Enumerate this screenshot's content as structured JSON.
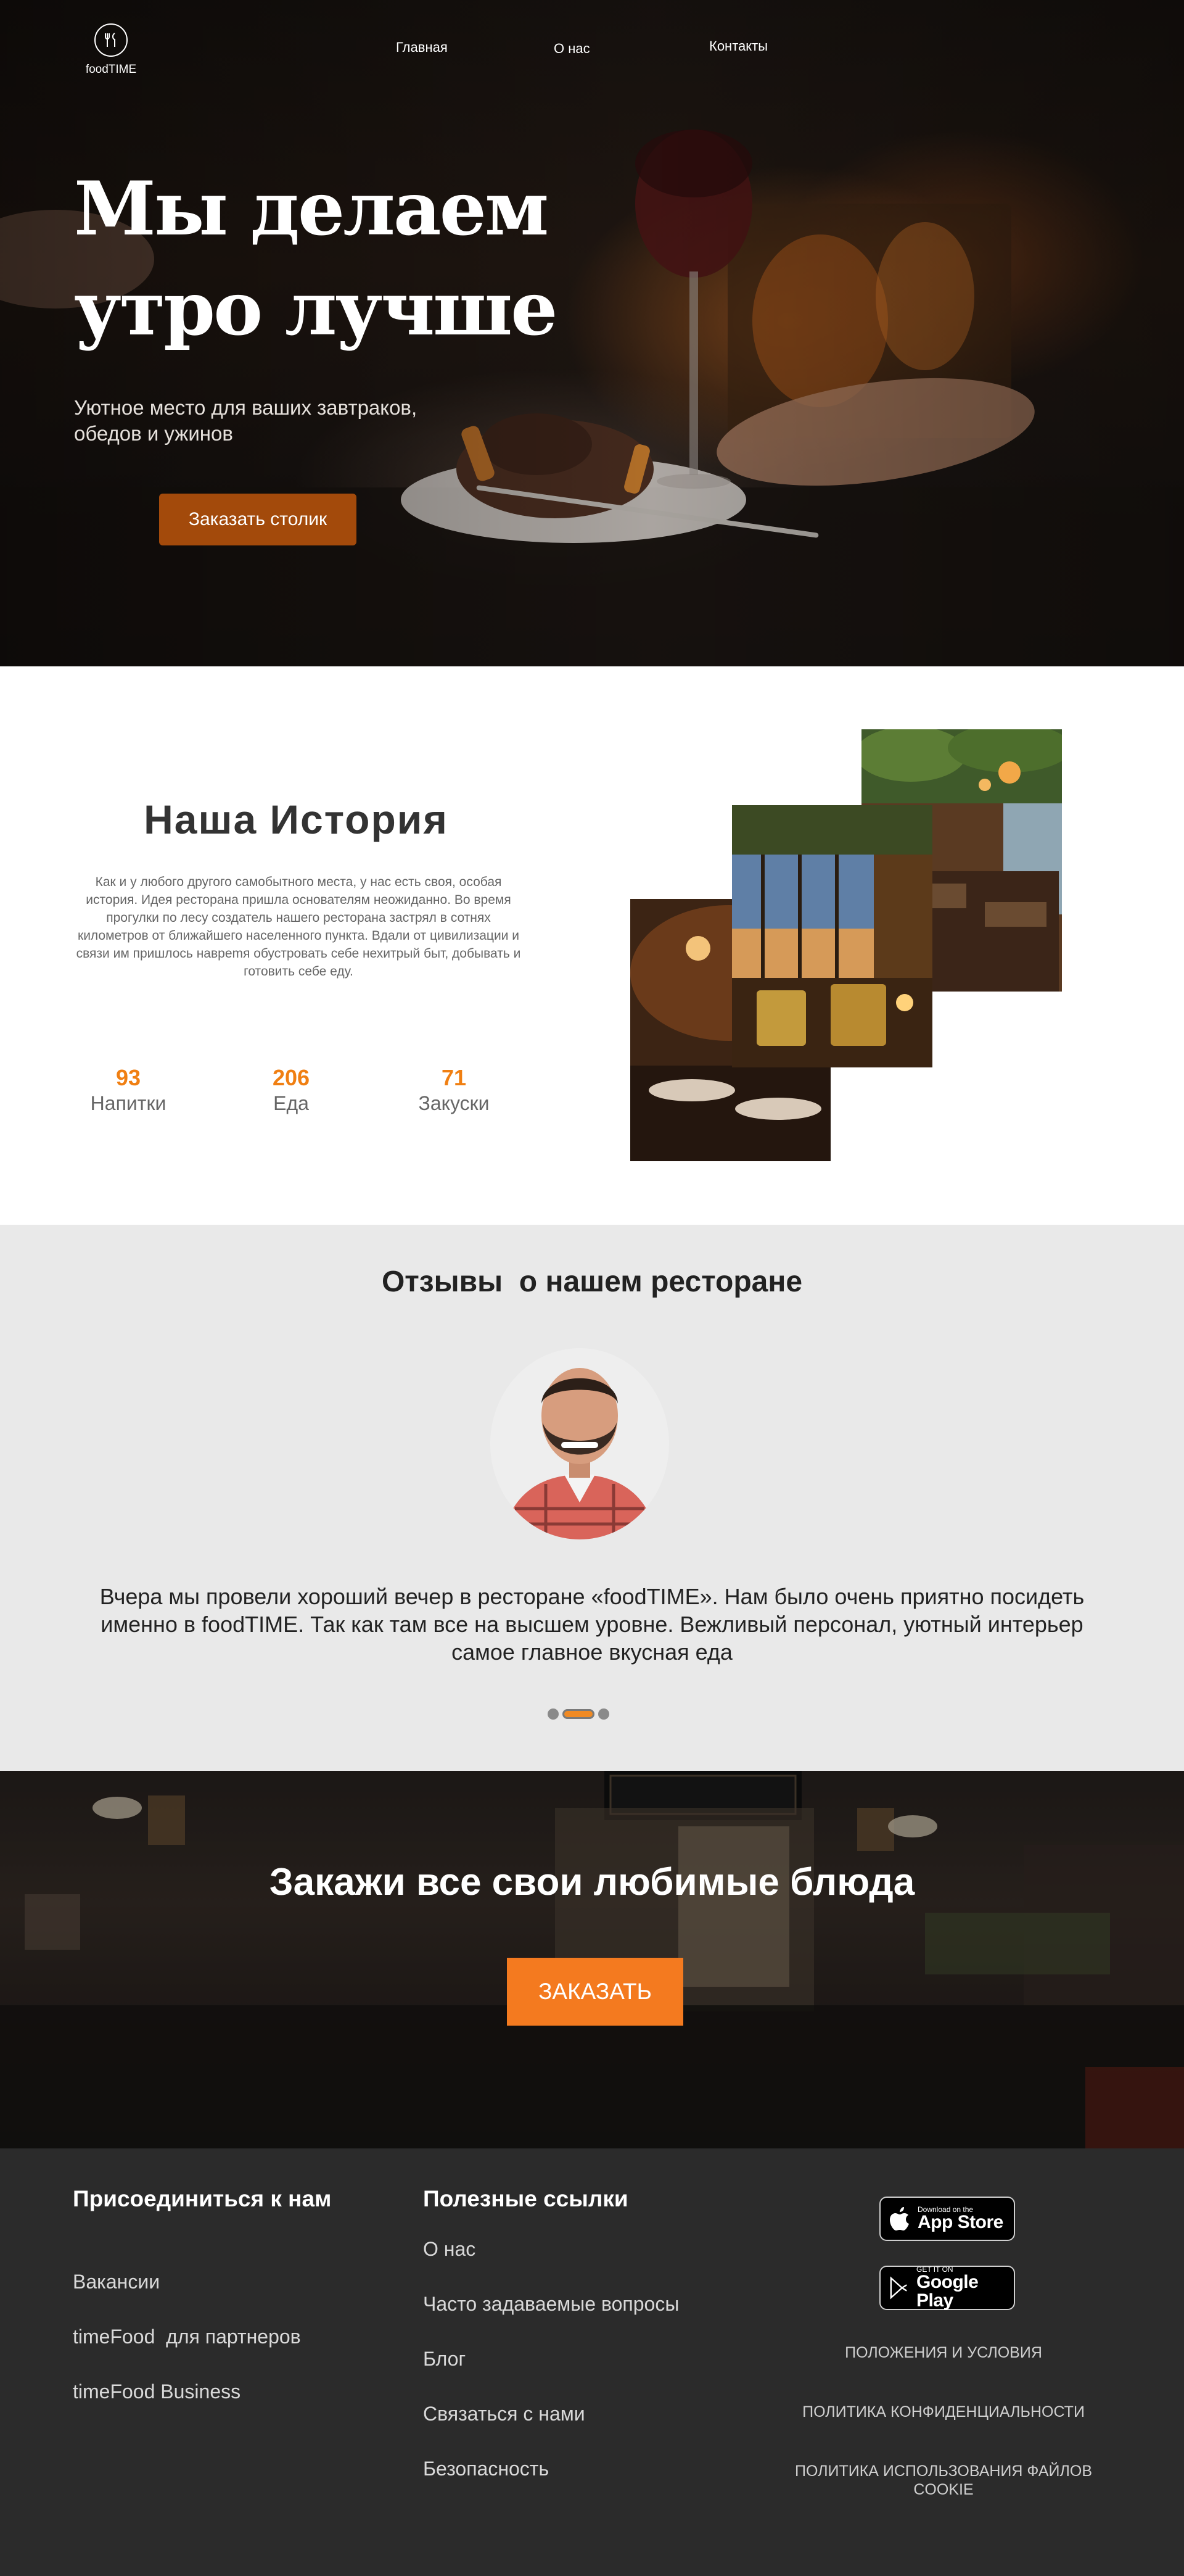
{
  "header": {
    "logo_text": "foodTIME",
    "nav": [
      "Главная",
      "О нас",
      "Контакты"
    ]
  },
  "hero": {
    "title_line1": "Мы делаем",
    "title_line2": "утро лучше",
    "subtitle_line1": "Уютное место для ваших завтраков,",
    "subtitle_line2": "обедов и ужинов",
    "cta_label": "Заказать столик"
  },
  "story": {
    "title": "Наша История",
    "text": "Как и у любого другого самобытного места, у нас есть своя, особая история. Идея ресторана пришла основателям неожиданно. Во время прогулки по лесу создатель нашего ресторана застрял в сотнях километров от ближайшего населенного пункта. Вдали от цивилизации и связи им пришлось наврemя обустровать себе нехитрый быт, добывать и готовить себе еду.",
    "stats": [
      {
        "value": "93",
        "label": "Напитки"
      },
      {
        "value": "206",
        "label": "Еда"
      },
      {
        "value": "71",
        "label": "Закуски"
      }
    ]
  },
  "reviews": {
    "title": "Отзывы  о нашем ресторане",
    "text": "Вчера мы провели хороший вечер в ресторане «foodTIME». Нам было очень приятно посидеть именно в foodTIME. Так как там все на высшем уровне. Вежливый персонал, уютный интерьер самое главное вкусная еда",
    "slide_count": 3,
    "active_slide": 2
  },
  "order": {
    "title": "Закажи все свои любимые блюда",
    "cta_label": "ЗАКАЗАТЬ"
  },
  "footer": {
    "join_title": "Присоединиться к нам",
    "join_links": [
      "Вакансии",
      "timeFood  для партнеров",
      "timeFood Business"
    ],
    "links_title": "Полезные ссылки",
    "useful_links": [
      "О нас",
      "Часто задаваемые вопросы",
      "Блог",
      "Связаться с нами",
      "Безопасность"
    ],
    "app_store": {
      "small": "Download on the",
      "big": "App Store"
    },
    "google_play": {
      "small": "GET IT ON",
      "big": "Google Play"
    },
    "policies": [
      "ПОЛОЖЕНИЯ И УСЛОВИЯ",
      "ПОЛИТИКА КОНФИДЕНЦИАЛЬНОСТИ",
      "ПОЛИТИКА ИСПОЛЬЗОВАНИЯ ФАЙЛОВ COOKIE"
    ]
  },
  "colors": {
    "accent": "#f47a1f",
    "hero_button": "#a34a0b",
    "stat_number": "#f07f12",
    "reviews_bg": "#e9e9e9",
    "footer_bg": "#2b2b2b"
  }
}
